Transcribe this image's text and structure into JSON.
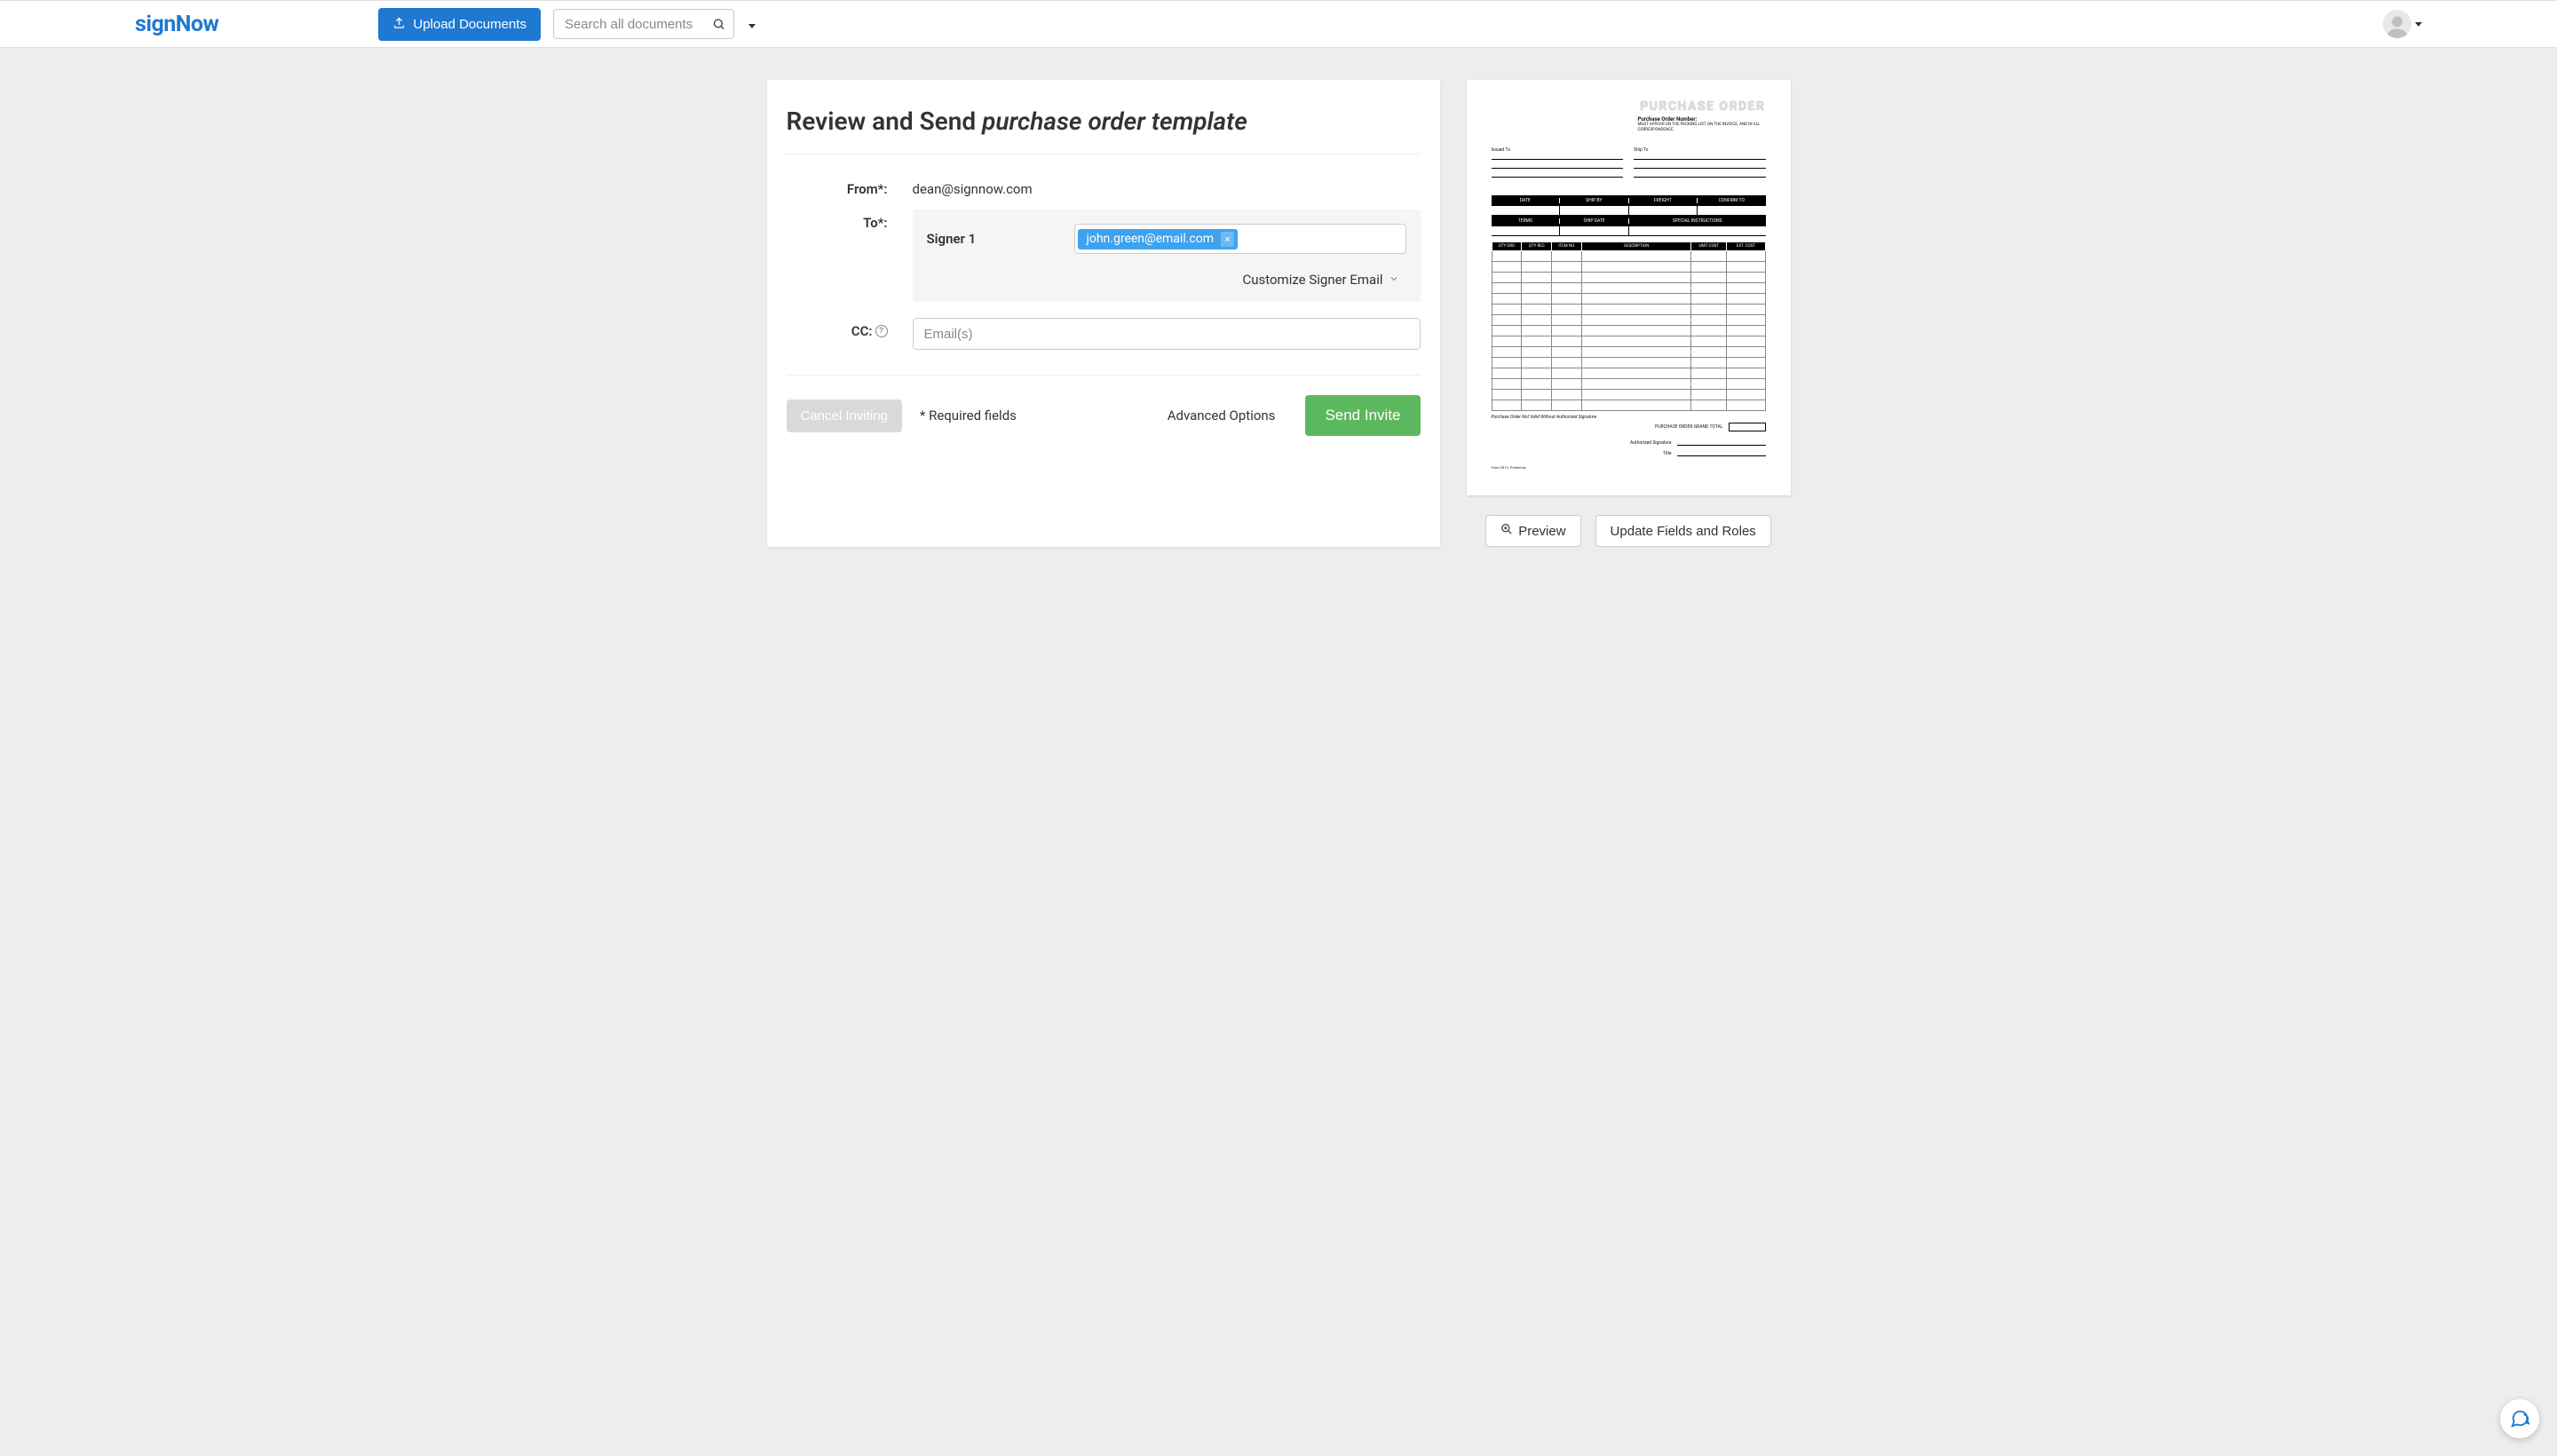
{
  "header": {
    "logo": "signNow",
    "upload_label": "Upload Documents",
    "search_placeholder": "Search all documents"
  },
  "title": {
    "prefix": "Review and Send ",
    "document_name": "purchase order template"
  },
  "form": {
    "from_label": "From*:",
    "from_value": "dean@signnow.com",
    "to_label": "To*:",
    "signer_label": "Signer 1",
    "signer_email": "john.green@email.com",
    "customize_label": "Customize Signer Email",
    "cc_label": "CC:",
    "cc_placeholder": "Email(s)"
  },
  "footer": {
    "cancel_label": "Cancel Inviting",
    "required_note": "* Required fields",
    "advanced_label": "Advanced Options",
    "send_label": "Send Invite"
  },
  "preview": {
    "title": "PURCHASE ORDER",
    "subtitle": "Purchase Order Number:",
    "note": "MUST APPEAR ON THE PACKING LIST, ON THE INVOICE, AND IN ALL CORRESPONDENCE.",
    "issued_to": "Issued To",
    "ship_to": "Ship To",
    "bar1": [
      "DATE",
      "SHIP BY",
      "FREIGHT",
      "CONFIRM TO"
    ],
    "bar2": [
      "TERMS",
      "SHIP DATE",
      "SPECIAL INSTRUCTIONS"
    ],
    "table_headers": [
      "QTY ORD",
      "QTY REC",
      "ITEM NO.",
      "DESCRIPTION",
      "UNIT COST",
      "EXT. COST"
    ],
    "invalid_note": "Purchase Order Not Valid Without Authorized Signature",
    "grand_total": "PURCHASE ORDER GRAND TOTAL",
    "auth_sig": "Authorized Signature",
    "title_label": "Title",
    "form_id": "Form 2013. Printed by"
  },
  "side_buttons": {
    "preview_label": "Preview",
    "update_label": "Update Fields and Roles"
  }
}
